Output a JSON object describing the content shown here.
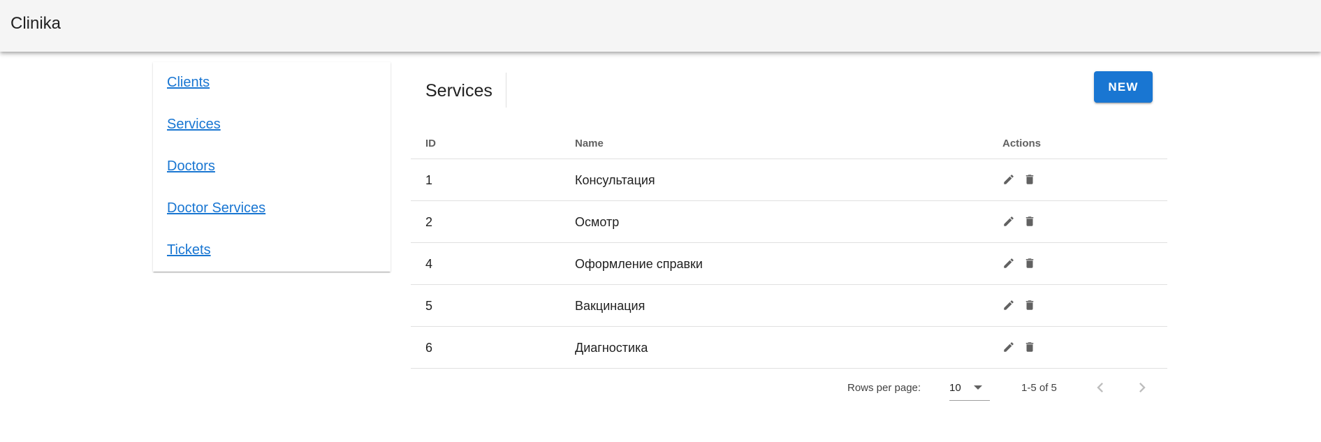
{
  "app": {
    "title": "Clinika"
  },
  "sidebar": {
    "items": [
      {
        "label": "Clients"
      },
      {
        "label": "Services"
      },
      {
        "label": "Doctors"
      },
      {
        "label": "Doctor Services"
      },
      {
        "label": "Tickets"
      }
    ]
  },
  "page": {
    "title": "Services",
    "new_button": "NEW"
  },
  "table": {
    "headers": {
      "id": "ID",
      "name": "Name",
      "actions": "Actions"
    },
    "rows": [
      {
        "id": "1",
        "name": "Консультация"
      },
      {
        "id": "2",
        "name": "Осмотр"
      },
      {
        "id": "4",
        "name": "Оформление справки"
      },
      {
        "id": "5",
        "name": "Вакцинация"
      },
      {
        "id": "6",
        "name": "Диагностика"
      }
    ]
  },
  "pagination": {
    "rows_per_page_label": "Rows per page:",
    "rows_per_page_value": "10",
    "range": "1-5 of 5"
  },
  "colors": {
    "accent": "#1976d2",
    "appbar": "#f5f5f5",
    "icon": "#616161",
    "icon_disabled": "#bdbdbd"
  },
  "icons": {
    "edit": "pencil-icon",
    "delete": "trash-icon",
    "dropdown": "caret-down-icon",
    "prev": "chevron-left-icon",
    "next": "chevron-right-icon"
  }
}
